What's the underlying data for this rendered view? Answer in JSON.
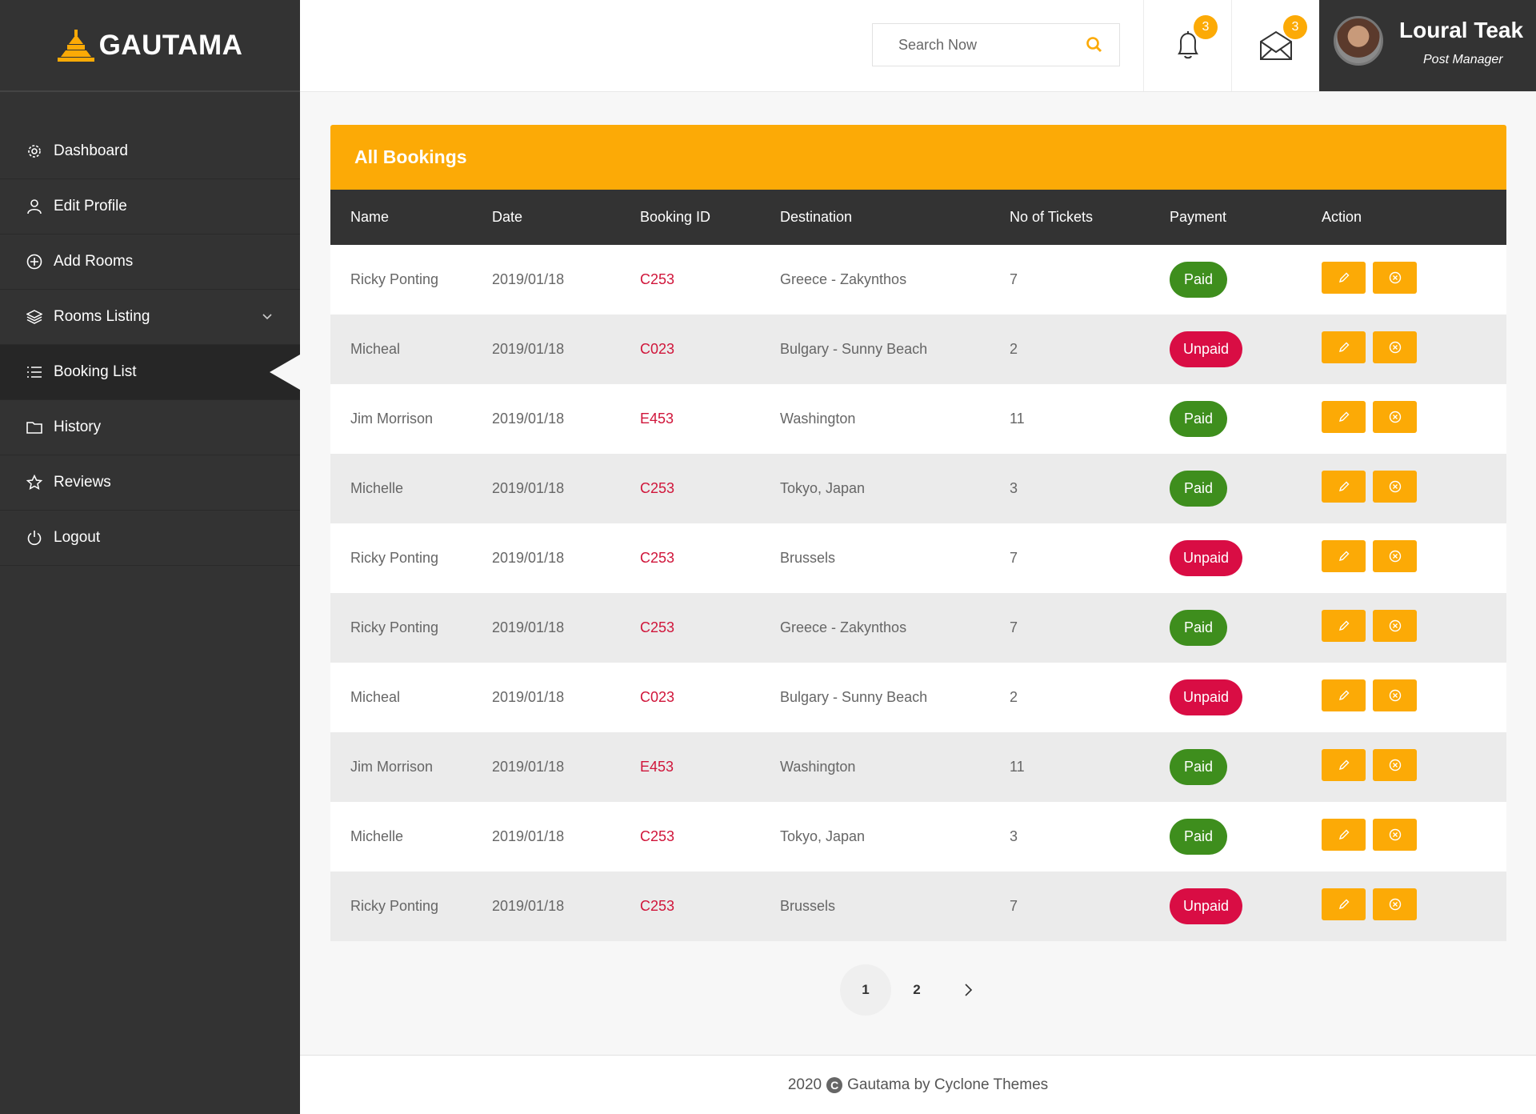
{
  "brand": {
    "name": "GAUTAMA",
    "accent": "#fcaa06"
  },
  "sidebar": {
    "items": [
      {
        "label": "Dashboard",
        "icon": "gear-icon"
      },
      {
        "label": "Edit Profile",
        "icon": "user-icon"
      },
      {
        "label": "Add Rooms",
        "icon": "plus-circle-icon"
      },
      {
        "label": "Rooms Listing",
        "icon": "layers-icon"
      },
      {
        "label": "Booking List",
        "icon": "list-icon",
        "active": true
      },
      {
        "label": "History",
        "icon": "folder-icon"
      },
      {
        "label": "Reviews",
        "icon": "star-icon"
      },
      {
        "label": "Logout",
        "icon": "power-icon"
      }
    ]
  },
  "header": {
    "search_placeholder": "Search Now",
    "notifications_count": "3",
    "messages_count": "3",
    "user": {
      "name": "Loural Teak",
      "role": "Post Manager"
    }
  },
  "bookings": {
    "title": "All Bookings",
    "columns": [
      "Name",
      "Date",
      "Booking ID",
      "Destination",
      "No of Tickets",
      "Payment",
      "Action"
    ],
    "rows": [
      {
        "name": "Ricky Ponting",
        "date": "2019/01/18",
        "id": "C253",
        "destination": "Greece - Zakynthos",
        "tickets": "7",
        "payment": "Paid"
      },
      {
        "name": "Micheal",
        "date": "2019/01/18",
        "id": "C023",
        "destination": "Bulgary - Sunny Beach",
        "tickets": "2",
        "payment": "Unpaid"
      },
      {
        "name": "Jim Morrison",
        "date": "2019/01/18",
        "id": "E453",
        "destination": "Washington",
        "tickets": "11",
        "payment": "Paid"
      },
      {
        "name": "Michelle",
        "date": "2019/01/18",
        "id": "C253",
        "destination": "Tokyo, Japan",
        "tickets": "3",
        "payment": "Paid"
      },
      {
        "name": "Ricky Ponting",
        "date": "2019/01/18",
        "id": "C253",
        "destination": "Brussels",
        "tickets": "7",
        "payment": "Unpaid"
      },
      {
        "name": "Ricky Ponting",
        "date": "2019/01/18",
        "id": "C253",
        "destination": "Greece - Zakynthos",
        "tickets": "7",
        "payment": "Paid"
      },
      {
        "name": "Micheal",
        "date": "2019/01/18",
        "id": "C023",
        "destination": "Bulgary - Sunny Beach",
        "tickets": "2",
        "payment": "Unpaid"
      },
      {
        "name": "Jim Morrison",
        "date": "2019/01/18",
        "id": "E453",
        "destination": "Washington",
        "tickets": "11",
        "payment": "Paid"
      },
      {
        "name": "Michelle",
        "date": "2019/01/18",
        "id": "C253",
        "destination": "Tokyo, Japan",
        "tickets": "3",
        "payment": "Paid"
      },
      {
        "name": "Ricky Ponting",
        "date": "2019/01/18",
        "id": "C253",
        "destination": "Brussels",
        "tickets": "7",
        "payment": "Unpaid"
      }
    ]
  },
  "pagination": {
    "pages": [
      "1",
      "2"
    ],
    "current": "1"
  },
  "footer": {
    "year": "2020",
    "text": "Gautama by Cyclone Themes"
  }
}
